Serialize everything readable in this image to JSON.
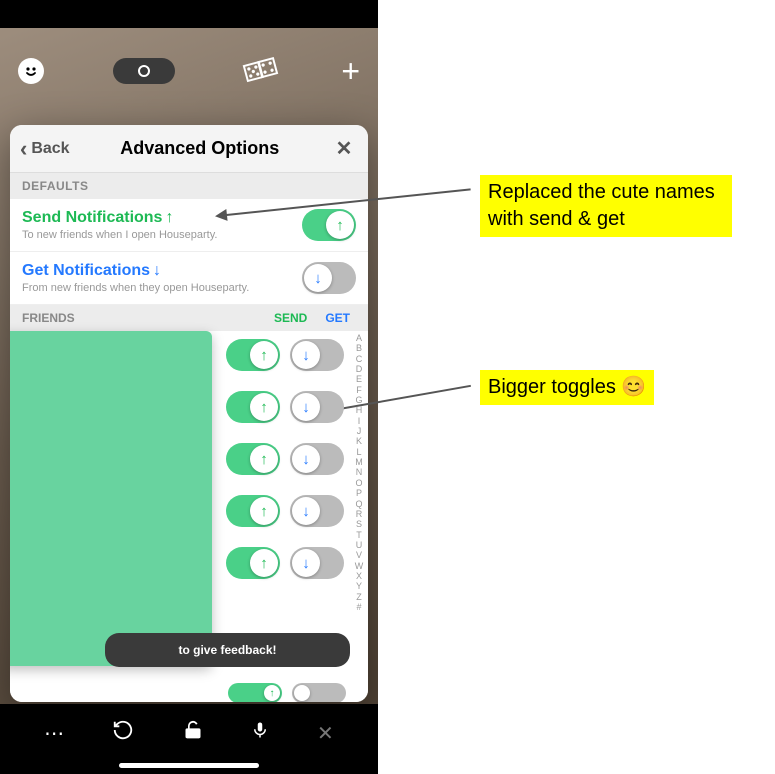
{
  "statusBar": {
    "pill_icon": "circle"
  },
  "modal": {
    "back_label": "Back",
    "title": "Advanced Options",
    "close_label": "✕",
    "defaults_label": "DEFAULTS",
    "send": {
      "title": "Send Notifications",
      "arrow": "↑",
      "sub": "To new friends when I open Houseparty.",
      "toggle_on": true
    },
    "get": {
      "title": "Get Notifications",
      "arrow": "↓",
      "sub": "From new friends when they open Houseparty.",
      "toggle_on": false
    },
    "friends_label": "FRIENDS",
    "col_send": "SEND",
    "col_get": "GET",
    "feedback": "to give feedback!",
    "indexLetters": [
      "A",
      "B",
      "C",
      "D",
      "E",
      "F",
      "G",
      "H",
      "I",
      "J",
      "K",
      "L",
      "M",
      "N",
      "O",
      "P",
      "Q",
      "R",
      "S",
      "T",
      "U",
      "V",
      "W",
      "X",
      "Y",
      "Z",
      "#"
    ],
    "friend_rows": [
      {
        "send": true,
        "get": false
      },
      {
        "send": true,
        "get": false
      },
      {
        "send": true,
        "get": false
      },
      {
        "send": true,
        "get": false
      },
      {
        "send": true,
        "get": false
      }
    ]
  },
  "annotations": {
    "a1": "Replaced the cute names with send & get",
    "a2": "Bigger toggles 😊"
  },
  "bottomBar": {
    "icons": [
      "more",
      "rotate",
      "unlock",
      "mic",
      "close"
    ]
  }
}
